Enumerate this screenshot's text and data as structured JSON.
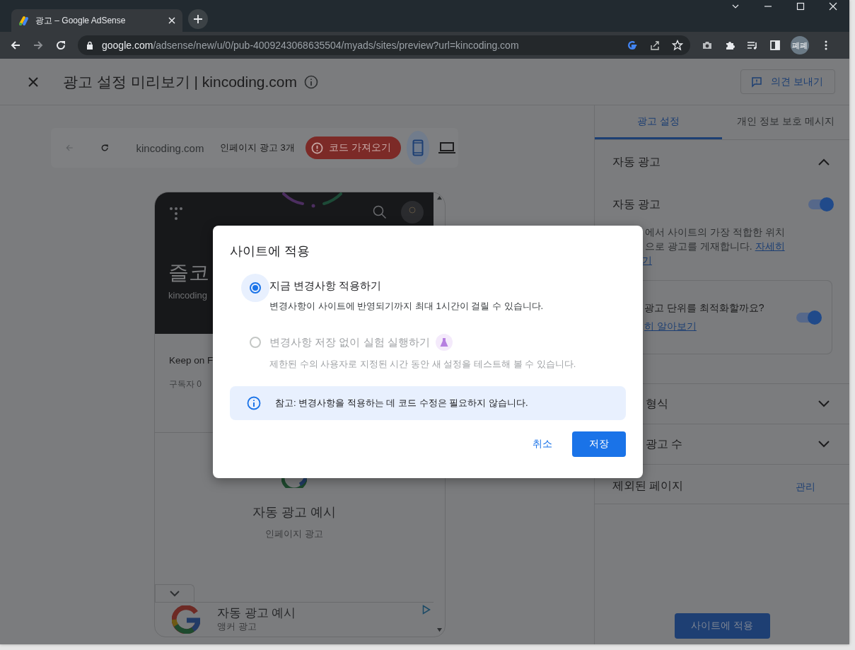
{
  "browser": {
    "tab_title": "광고 – Google AdSense",
    "url_host": "google.com",
    "url_path": "/adsense/new/u/0/pub-4009243068635504/myads/sites/preview?url=kincoding.com",
    "profile": "폐폐"
  },
  "header": {
    "title": "광고 설정 미리보기 | kincoding.com",
    "feedback_button": "의견 보내기"
  },
  "preview_bar": {
    "site": "kincoding.com",
    "ad_count": "인페이지 광고 3개",
    "code_button": "코드 가져오기",
    "devices": [
      {
        "kind": "phone",
        "selected": true
      },
      {
        "kind": "laptop",
        "selected": false
      }
    ]
  },
  "phone": {
    "site_title": "즐코",
    "site_domain": "kincoding",
    "post_title": "Keep on F",
    "subscribers": "구독자 0",
    "inpage_ad": {
      "title": "자동 광고 예시",
      "subtitle": "인페이지 광고"
    },
    "anchor_ad": {
      "title": "자동 광고 예시",
      "subtitle": "앵커 광고"
    }
  },
  "side_panel": {
    "tabs": [
      {
        "label": "광고 설정",
        "selected": true
      },
      {
        "label": "개인 정보 보호 메시지",
        "selected": false
      }
    ],
    "auto_ads": {
      "heading": "자동 광고",
      "expanded": true,
      "toggle_label": "자동 광고",
      "toggle_on": true,
      "description_lines": [
        "에서 사이트의 가장 적합한 위치",
        "으로 광고를 게재합니다."
      ],
      "link_lines": [
        "자세히",
        "기"
      ]
    },
    "optimize": {
      "question": "광고 단위를 최적화할까요?",
      "on": true,
      "link": "히 알아보기"
    },
    "sections": [
      {
        "label": "형식",
        "expanded": false
      },
      {
        "label": "광고 수",
        "expanded": false
      }
    ],
    "excluded": {
      "label": "제외된 페이지",
      "action": "관리"
    },
    "apply_button": "사이트에 적용"
  },
  "dialog": {
    "title": "사이트에 적용",
    "options": [
      {
        "label": "지금 변경사항 적용하기",
        "description": "변경사항이 사이트에 반영되기까지 최대 1시간이 걸릴 수 있습니다.",
        "selected": true,
        "disabled": false,
        "experiment": false
      },
      {
        "label": "변경사항 저장 없이 실험 실행하기",
        "description": "제한된 수의 사용자로 지정된 시간 동안 새 설정을 테스트해 볼 수 있습니다.",
        "selected": false,
        "disabled": true,
        "experiment": true
      }
    ],
    "note": "참고: 변경사항을 적용하는 데 코드 수정은 필요하지 않습니다.",
    "buttons": [
      {
        "label": "취소",
        "kind": "text"
      },
      {
        "label": "저장",
        "kind": "primary"
      }
    ]
  }
}
